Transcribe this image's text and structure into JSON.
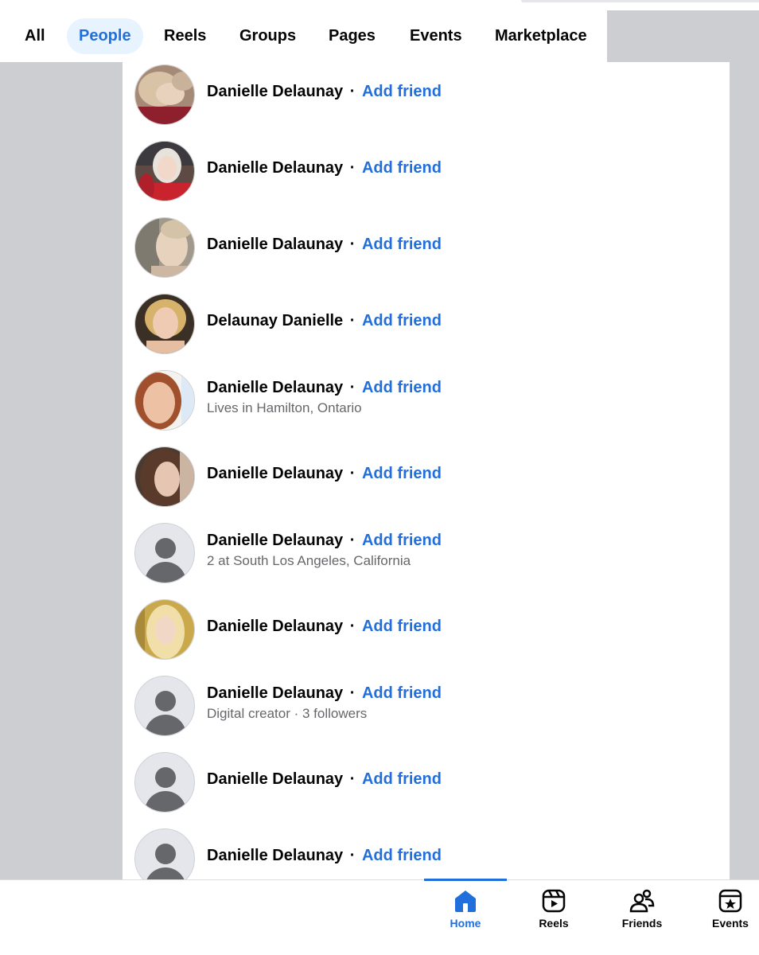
{
  "tabs": [
    {
      "label": "All",
      "active": false
    },
    {
      "label": "People",
      "active": true
    },
    {
      "label": "Reels",
      "active": false
    },
    {
      "label": "Groups",
      "active": false
    },
    {
      "label": "Pages",
      "active": false
    },
    {
      "label": "Events",
      "active": false
    },
    {
      "label": "Marketplace",
      "active": false
    }
  ],
  "separator": "·",
  "results": [
    {
      "name": "Danielle Delaunay",
      "action": "Add friend",
      "subtitle": "",
      "avatar": "photo"
    },
    {
      "name": "Danielle Delaunay",
      "action": "Add friend",
      "subtitle": "",
      "avatar": "photo"
    },
    {
      "name": "Danielle Dalaunay",
      "action": "Add friend",
      "subtitle": "",
      "avatar": "photo"
    },
    {
      "name": "Delaunay Danielle",
      "action": "Add friend",
      "subtitle": "",
      "avatar": "photo"
    },
    {
      "name": "Danielle Delaunay",
      "action": "Add friend",
      "subtitle": "Lives in Hamilton, Ontario",
      "avatar": "photo"
    },
    {
      "name": "Danielle Delaunay",
      "action": "Add friend",
      "subtitle": "",
      "avatar": "photo"
    },
    {
      "name": "Danielle Delaunay",
      "action": "Add friend",
      "subtitle": "2 at South Los Angeles, California",
      "avatar": "placeholder"
    },
    {
      "name": "Danielle Delaunay",
      "action": "Add friend",
      "subtitle": "",
      "avatar": "photo"
    },
    {
      "name": "Danielle Delaunay",
      "action": "Add friend",
      "subtitle": "Digital creator · 3 followers",
      "avatar": "placeholder"
    },
    {
      "name": "Danielle Delaunay",
      "action": "Add friend",
      "subtitle": "",
      "avatar": "placeholder"
    },
    {
      "name": "Danielle Delaunay",
      "action": "Add friend",
      "subtitle": "",
      "avatar": "placeholder"
    }
  ],
  "bottom_nav": [
    {
      "label": "Home",
      "icon": "home-icon",
      "active": true
    },
    {
      "label": "Reels",
      "icon": "reels-icon",
      "active": false
    },
    {
      "label": "Friends",
      "icon": "friends-icon",
      "active": false
    },
    {
      "label": "Events",
      "icon": "events-icon",
      "active": false
    }
  ],
  "colors": {
    "accent": "#216fdb",
    "text": "#050505",
    "secondary": "#65676b",
    "side_bg": "#ccced2",
    "active_tab_bg": "#e7f3ff"
  }
}
